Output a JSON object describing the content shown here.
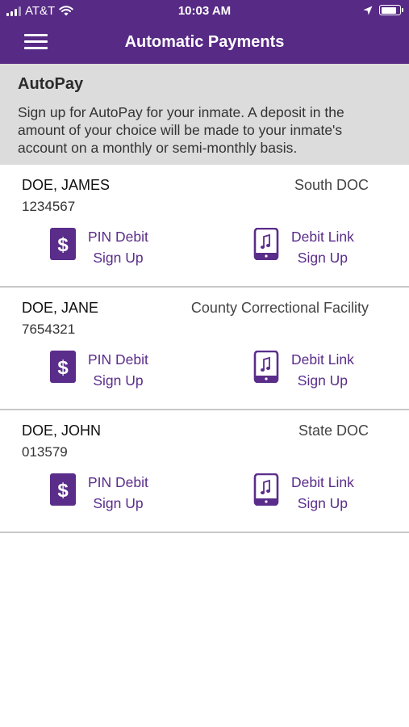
{
  "status_bar": {
    "carrier": "AT&T",
    "time": "10:03 AM"
  },
  "header": {
    "title": "Automatic Payments"
  },
  "intro": {
    "title": "AutoPay",
    "text": "Sign up for AutoPay for your inmate. A deposit in the amount of your choice will be made to your inmate's account on a monthly or semi-monthly basis."
  },
  "inmates": [
    {
      "name": "DOE, JAMES",
      "id": "1234567",
      "facility": "South DOC",
      "pin_debit_line1": "PIN Debit",
      "pin_debit_line2": "Sign Up",
      "debit_link_line1": "Debit Link",
      "debit_link_line2": "Sign Up"
    },
    {
      "name": "DOE, JANE",
      "id": "7654321",
      "facility": "County Correctional Facility",
      "pin_debit_line1": "PIN Debit",
      "pin_debit_line2": "Sign Up",
      "debit_link_line1": "Debit Link",
      "debit_link_line2": "Sign Up"
    },
    {
      "name": "DOE, JOHN",
      "id": "013579",
      "facility": "State DOC",
      "pin_debit_line1": "PIN Debit",
      "pin_debit_line2": "Sign Up",
      "debit_link_line1": "Debit Link",
      "debit_link_line2": "Sign Up"
    }
  ],
  "colors": {
    "brand": "#572a85",
    "link": "#5a2d8a",
    "intro_bg": "#dcdcdc",
    "divider": "#c8c8c8"
  },
  "icons": {
    "pin_debit": "dollar-badge-icon",
    "debit_link": "phone-music-icon"
  }
}
